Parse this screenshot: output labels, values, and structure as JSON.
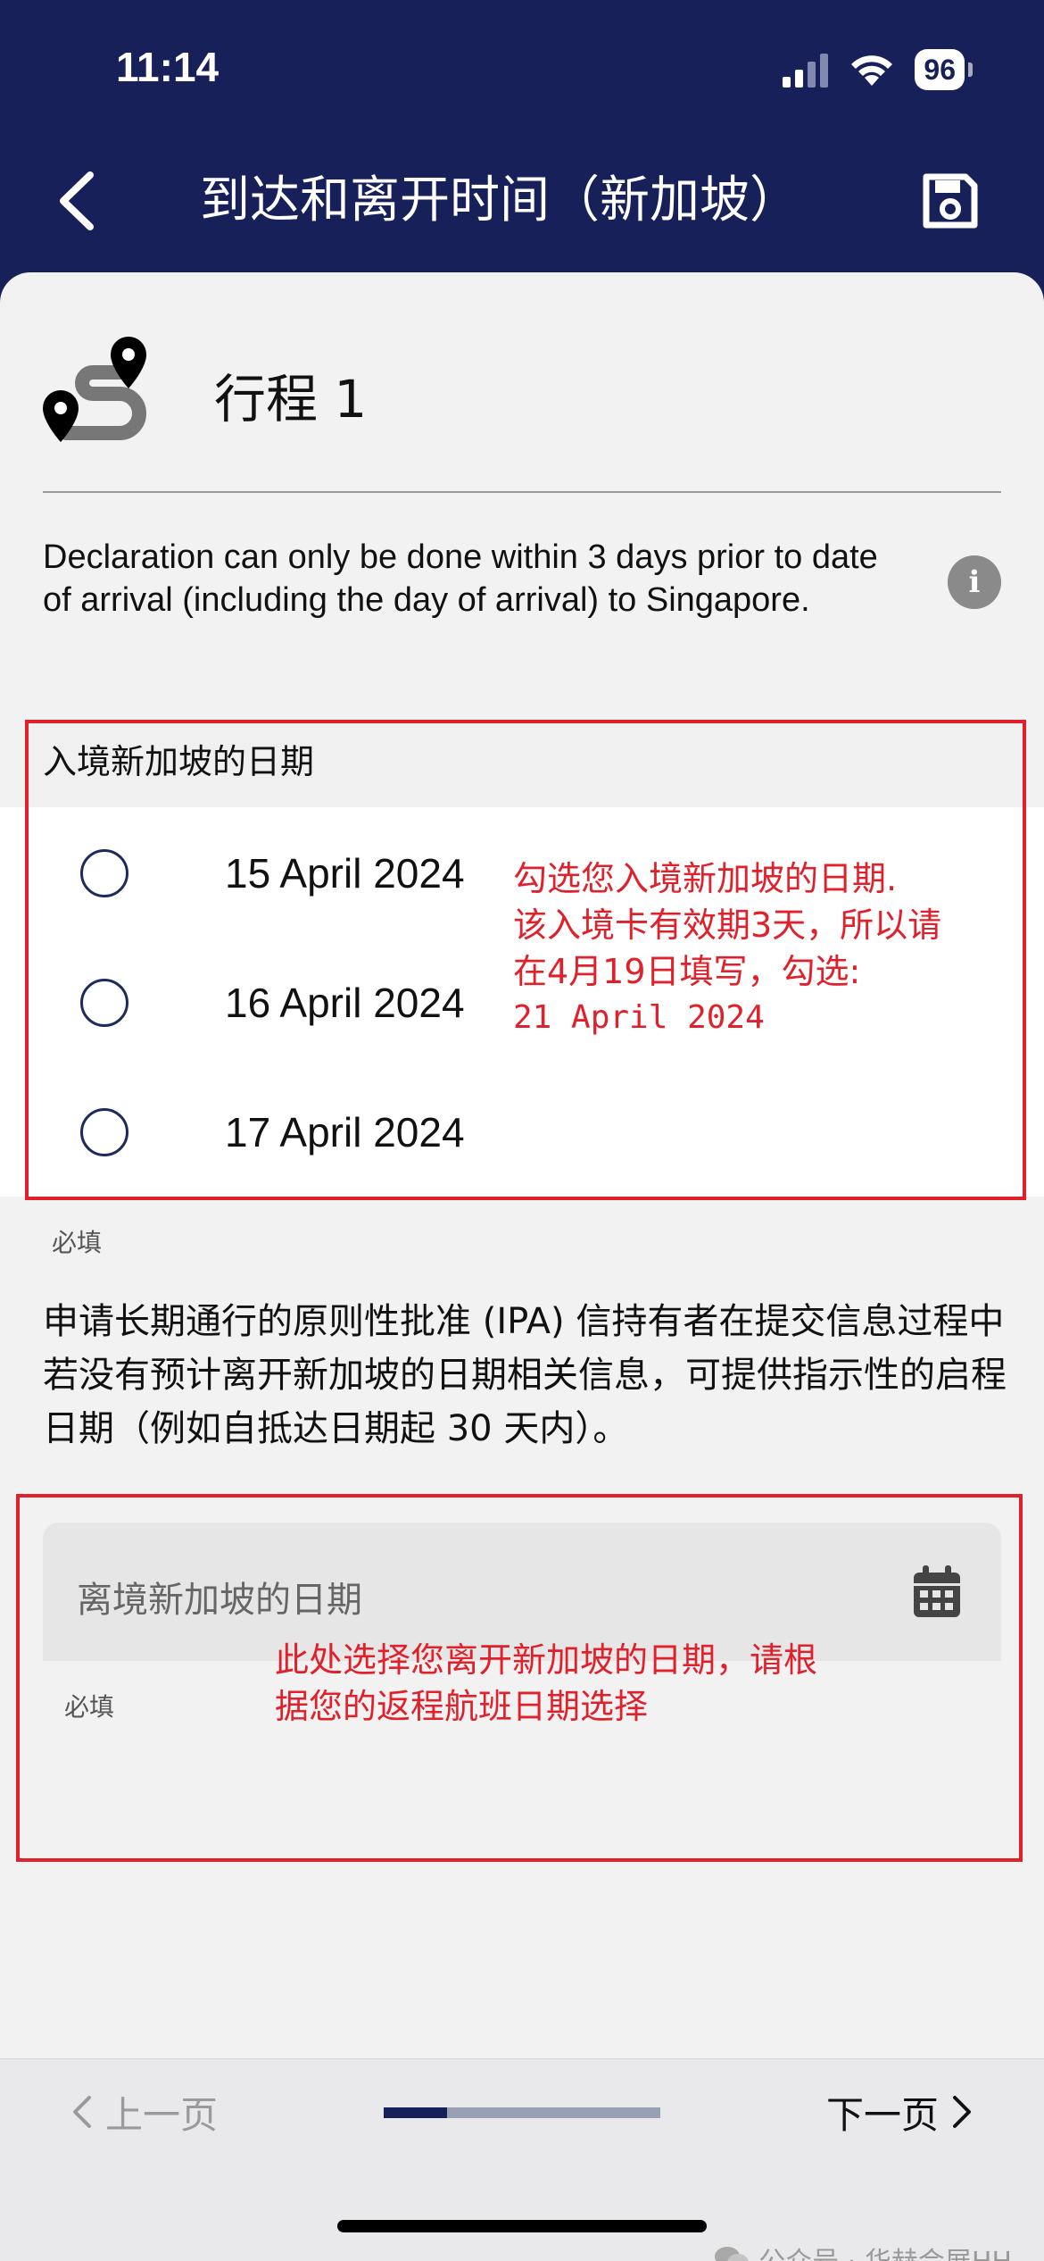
{
  "status_bar": {
    "time": "11:14",
    "battery": "96"
  },
  "header": {
    "title": "到达和离开时间（新加坡）"
  },
  "trip": {
    "title": "行程 1"
  },
  "notice": "Declaration can only be done within 3 days prior to date of arrival (including the day of arrival) to Singapore.",
  "arrival": {
    "label": "入境新加坡的日期",
    "options": [
      {
        "label": "15 April 2024",
        "selected": false
      },
      {
        "label": "16 April 2024",
        "selected": false
      },
      {
        "label": "17 April 2024",
        "selected": false
      }
    ],
    "required": "必填"
  },
  "annotation_arrival": {
    "line1": "勾选您入境新加坡的日期.",
    "line2": "该入境卡有效期3天，所以请",
    "line3": "在4月19日填写，勾选:",
    "line4": "21 April 2024"
  },
  "ipa_text": "申请长期通行的原则性批准 (IPA) 信持有者在提交信息过程中若没有预计离开新加坡的日期相关信息，可提供指示性的启程日期（例如自抵达日期起 30 天内）。",
  "departure": {
    "placeholder": "离境新加坡的日期",
    "required": "必填"
  },
  "annotation_departure": {
    "line1": "此处选择您离开新加坡的日期，请根",
    "line2": "据您的返程航班日期选择"
  },
  "footer": {
    "prev": "上一页",
    "next": "下一页",
    "progress": 0.23
  },
  "watermark": "公众号 · 华赫会展HH",
  "colors": {
    "header_bg": "#18205a",
    "annotation": "#e0202a"
  }
}
